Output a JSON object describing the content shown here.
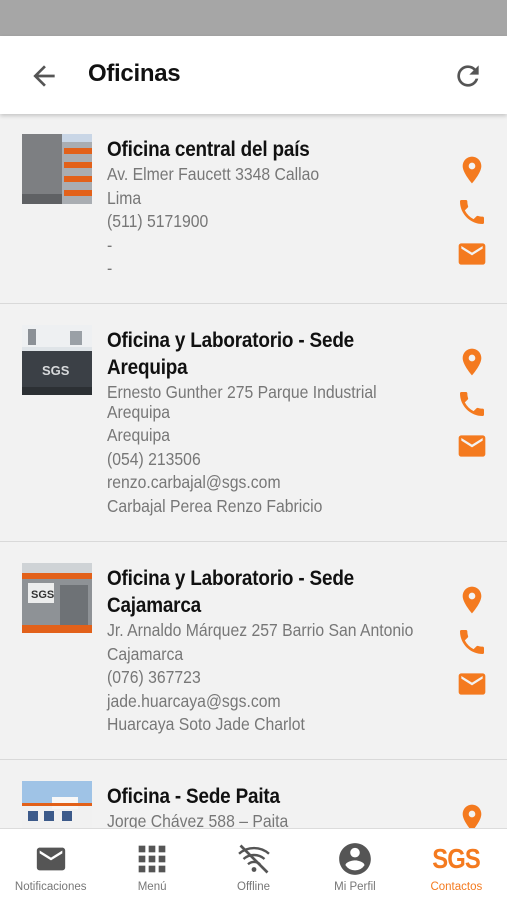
{
  "header": {
    "title": "Oficinas"
  },
  "offices": [
    {
      "name_lines": [
        "Oficina central del país"
      ],
      "details": [
        "Av. Elmer Faucett 3348 Callao",
        "Lima",
        "(511) 5171900",
        "-",
        "-"
      ]
    },
    {
      "name_lines": [
        "Oficina y Laboratorio - Sede",
        "Arequipa"
      ],
      "details": [
        "Ernesto Gunther 275 Parque Industrial",
        "Arequipa",
        "Arequipa",
        "(054) 213506",
        "renzo.carbajal@sgs.com",
        "Carbajal Perea Renzo Fabricio"
      ]
    },
    {
      "name_lines": [
        "Oficina y Laboratorio - Sede",
        "Cajamarca"
      ],
      "details": [
        "Jr. Arnaldo Márquez 257 Barrio San Antonio",
        "Cajamarca",
        "(076) 367723",
        "jade.huarcaya@sgs.com",
        "Huarcaya Soto Jade Charlot"
      ]
    },
    {
      "name_lines": [
        "Oficina - Sede Paita"
      ],
      "details": [
        "Jorge Chávez 588 – Paita"
      ]
    }
  ],
  "bottom_nav": [
    {
      "label": "Notificaciones",
      "icon": "mail-icon"
    },
    {
      "label": "Menú",
      "icon": "grid-icon"
    },
    {
      "label": "Offline",
      "icon": "wifi-off-icon"
    },
    {
      "label": "Mi Perfil",
      "icon": "account-icon"
    },
    {
      "label": "Contactos",
      "icon": "sgs-logo",
      "logo_text": "SGS",
      "active": true
    }
  ],
  "colors": {
    "accent": "#f47a1f",
    "status_bar": "#a6a6a6"
  }
}
